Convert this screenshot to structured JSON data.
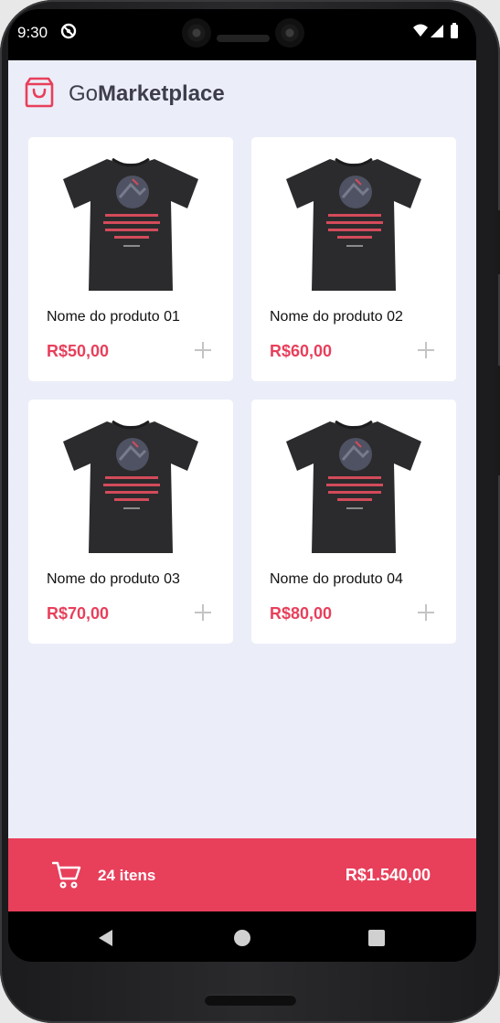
{
  "status_bar": {
    "time": "9:30"
  },
  "header": {
    "logo_prefix": "Go",
    "logo_bold": "Marketplace",
    "brand_color": "#e83f5b"
  },
  "products": [
    {
      "name": "Nome do produto 01",
      "price": "R$50,00",
      "icon": "plus-icon"
    },
    {
      "name": "Nome do produto 02",
      "price": "R$60,00",
      "icon": "plus-icon"
    },
    {
      "name": "Nome do produto 03",
      "price": "R$70,00",
      "icon": "plus-icon"
    },
    {
      "name": "Nome do produto 04",
      "price": "R$80,00",
      "icon": "plus-icon"
    }
  ],
  "cart": {
    "count_label": "24 itens",
    "total": "R$1.540,00",
    "icon": "shopping-cart-icon"
  },
  "system_nav": {
    "back_icon": "back-triangle-icon",
    "home_icon": "home-circle-icon",
    "recents_icon": "recents-square-icon"
  },
  "colors": {
    "background": "#ebeef8",
    "card": "#ffffff",
    "accent": "#e83f5b",
    "text": "#3d3d4d"
  }
}
